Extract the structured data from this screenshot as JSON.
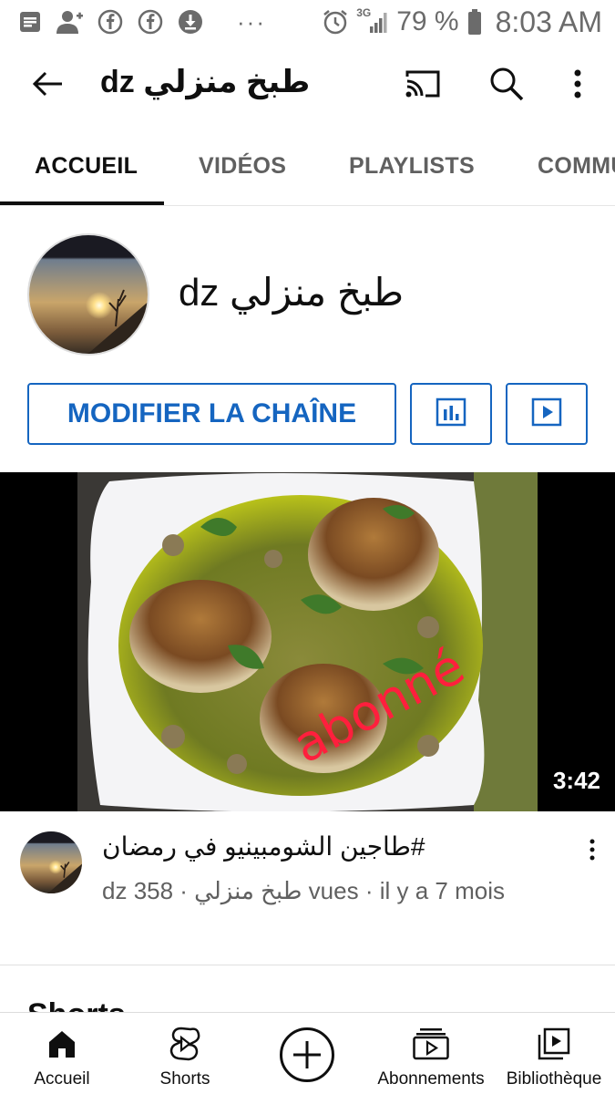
{
  "status_bar": {
    "icons": [
      "notes-icon",
      "person-add-icon",
      "facebook-icon",
      "facebook-icon",
      "download-icon",
      "more-dots-icon",
      "alarm-icon",
      "signal-3g-icon",
      "battery-icon"
    ],
    "more": "···",
    "network": "3G",
    "battery": "79 %",
    "time": "8:03 AM"
  },
  "app_bar": {
    "title": "طبخ منزلي dz",
    "icons": [
      "back-arrow-icon",
      "cast-icon",
      "search-icon",
      "more-vert-icon"
    ]
  },
  "tabs": [
    {
      "label": "ACCUEIL",
      "active": true
    },
    {
      "label": "VIDÉOS"
    },
    {
      "label": "PLAYLISTS"
    },
    {
      "label": "COMMU"
    }
  ],
  "channel": {
    "name": "طبخ منزلي dz",
    "modify_label": "MODIFIER LA CHAÎNE",
    "icons": [
      "analytics-icon",
      "video-manager-icon"
    ]
  },
  "video": {
    "overlay_text": "abonné",
    "duration": "3:42",
    "title": "#طاجين الشومبينيو في رمضان",
    "meta": "dz طبخ منزلي · 358 vues · il y a 7 mois"
  },
  "section": {
    "shorts_heading": "Shorts"
  },
  "bottom_nav": [
    {
      "label": "Accueil",
      "icon": "home-icon"
    },
    {
      "label": "Shorts",
      "icon": "shorts-icon"
    },
    {
      "label": "",
      "icon": "add-circle-icon"
    },
    {
      "label": "Abonnements",
      "icon": "subscriptions-icon"
    },
    {
      "label": "Bibliothèque",
      "icon": "library-icon"
    }
  ],
  "colors": {
    "accent_blue": "#1565c0",
    "secondary_text": "#606060",
    "overlay_red": "#ff1f3d"
  }
}
